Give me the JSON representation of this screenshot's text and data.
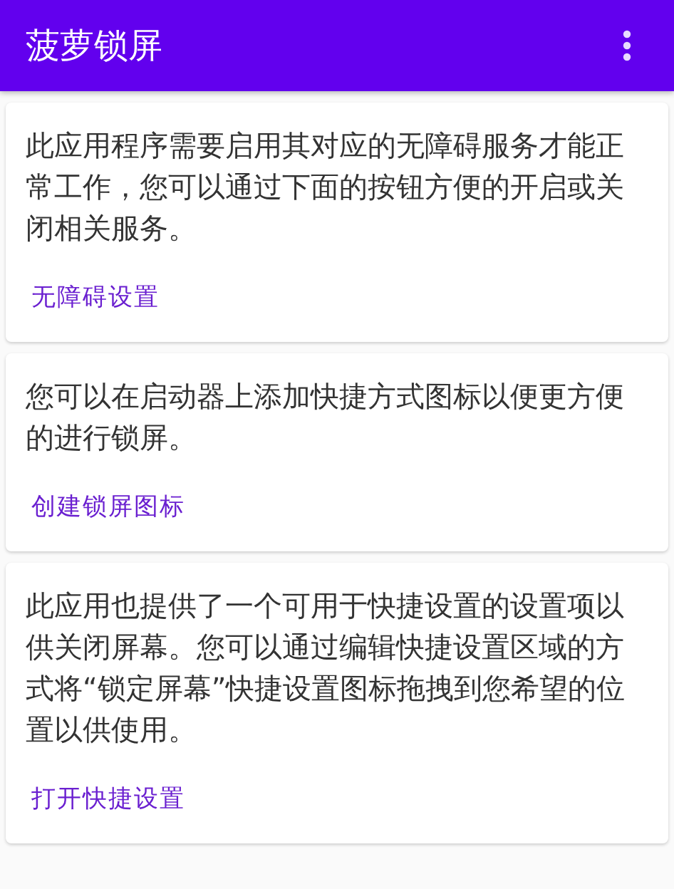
{
  "app_bar": {
    "title": "菠萝锁屏"
  },
  "cards": [
    {
      "text": "此应用程序需要启用其对应的无障碍服务才能正常工作，您可以通过下面的按钮方便的开启或关闭相关服务。",
      "button": "无障碍设置"
    },
    {
      "text": "您可以在启动器上添加快捷方式图标以便更方便的进行锁屏。",
      "button": "创建锁屏图标"
    },
    {
      "text": "此应用也提供了一个可用于快捷设置的设置项以供关闭屏幕。您可以通过编辑快捷设置区域的方式将“锁定屏幕”快捷设置图标拖拽到您希望的位置以供使用。",
      "button": "打开快捷设置"
    }
  ]
}
